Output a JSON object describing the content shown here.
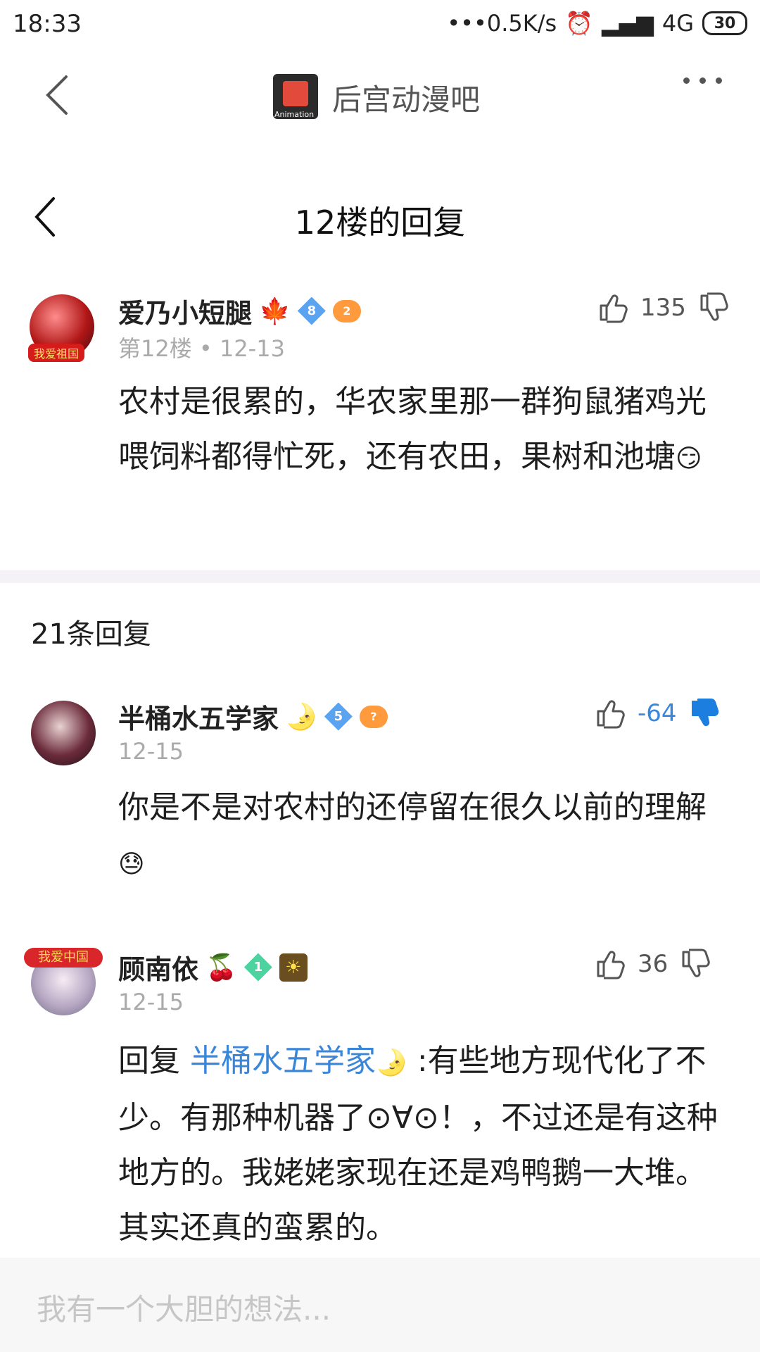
{
  "status_bar": {
    "time": "18:33",
    "network_speed": "•••0.5K/s",
    "network_type": "4G",
    "battery": "30"
  },
  "nav": {
    "forum_title": "后宫动漫吧",
    "logo_text": "Animation"
  },
  "subheader": {
    "title": "12楼的回复"
  },
  "main_post": {
    "username": "爱乃小短腿",
    "username_emoji": "🍁",
    "level": "8",
    "game_badge": "2",
    "floor": "第12楼",
    "date": "12-13",
    "likes": "135",
    "avatar_badge": "我爱祖国",
    "content": "农村是很累的，华农家里那一群狗鼠猪鸡光喂饲料都得忙死，还有农田，果树和池塘",
    "content_emoji": "😏"
  },
  "replies_header": "21条回复",
  "replies": [
    {
      "username": "半桶水五学家",
      "username_emoji": "🌛",
      "level": "5",
      "game_badge": "?",
      "date": "12-15",
      "likes": "-64",
      "content": "你是不是对农村的还停留在很久以前的理解",
      "content_emoji": "😓"
    },
    {
      "username": "顾南依",
      "username_emoji": "🍒",
      "level": "1",
      "badge": "☀",
      "avatar_banner": "我爱中国",
      "date": "12-15",
      "likes": "36",
      "reply_prefix": "回复",
      "reply_to": "半桶水五学家",
      "reply_to_emoji": "🌛",
      "content_line1": " :有些地方现代化了不少。有那种机器了⊙∀⊙！，不过还是有这种地方的。我姥姥家现在还是鸡鸭鹅一大堆。其实还真的蛮累的。"
    }
  ],
  "input": {
    "placeholder": "我有一个大胆的想法..."
  },
  "colors": {
    "accent": "#3a86d9",
    "divider": "#f4f2f6"
  }
}
